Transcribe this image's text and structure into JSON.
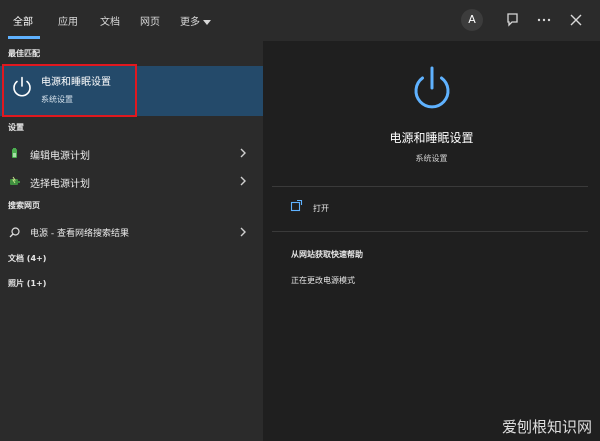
{
  "tabs": [
    {
      "label": "全部"
    },
    {
      "label": "应用"
    },
    {
      "label": "文档"
    },
    {
      "label": "网页"
    },
    {
      "label": "更多"
    }
  ],
  "topbar": {
    "avatar_letter": "A"
  },
  "left": {
    "best_match_header": "最佳匹配",
    "best_match": {
      "title": "电源和睡眠设置",
      "subtitle": "系统设置"
    },
    "settings_header": "设置",
    "settings_items": [
      {
        "label": "编辑电源计划"
      },
      {
        "label": "选择电源计划"
      }
    ],
    "web_header": "搜索网页",
    "web_item": {
      "label": "电源 - 查看网络搜索结果"
    },
    "docs_label": "文档 (4+)",
    "photos_label": "照片 (1+)"
  },
  "right": {
    "title": "电源和睡眠设置",
    "subtitle": "系统设置",
    "open_label": "打开",
    "help_header": "从网站获取快速帮助",
    "help_item": "正在更改电源模式"
  },
  "watermark": "爱刨根知识网",
  "colors": {
    "accent": "#5fb2ff",
    "selection": "#244a6a",
    "highlight_box": "#e0181f"
  }
}
